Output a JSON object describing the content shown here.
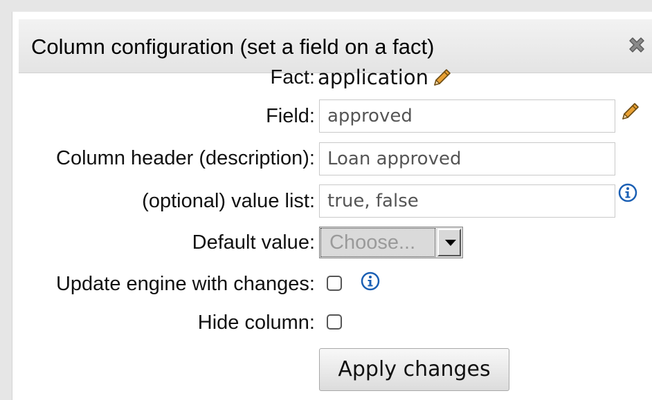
{
  "dialog": {
    "title": "Column configuration (set a field on a fact)",
    "close_icon": "close-x-icon"
  },
  "fields": {
    "fact_label": "Fact:",
    "fact_value": "application",
    "field_label": "Field:",
    "field_value": "approved",
    "header_label": "Column header (description):",
    "header_value": "Loan approved",
    "value_list_label": "(optional) value list:",
    "value_list_value": "true, false",
    "default_value_label": "Default value:",
    "default_value_selected": "Choose...",
    "update_engine_label": "Update engine with changes:",
    "update_engine_checked": false,
    "hide_column_label": "Hide column:",
    "hide_column_checked": false
  },
  "buttons": {
    "apply_label": "Apply changes"
  },
  "icons": {
    "edit": "pencil-icon",
    "info": "info-icon",
    "info_color": "#1a5fb4"
  }
}
